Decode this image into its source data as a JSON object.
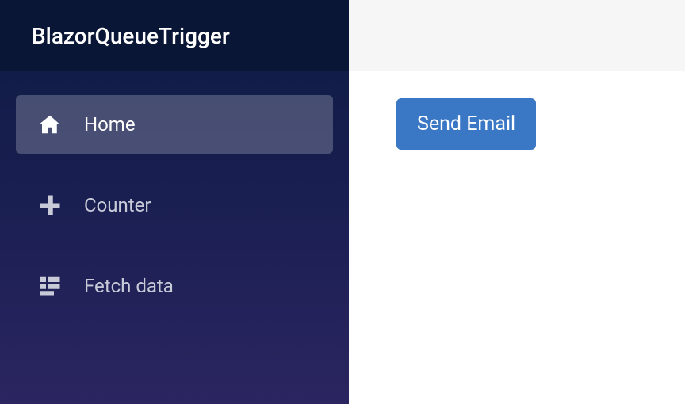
{
  "app": {
    "title": "BlazorQueueTrigger"
  },
  "sidebar": {
    "items": [
      {
        "label": "Home",
        "icon": "home-icon",
        "active": true
      },
      {
        "label": "Counter",
        "icon": "plus-icon",
        "active": false
      },
      {
        "label": "Fetch data",
        "icon": "list-icon",
        "active": false
      }
    ]
  },
  "main": {
    "sendEmailLabel": "Send Email"
  },
  "colors": {
    "primary": "#3a78c5",
    "sidebarTop": "#0a1635",
    "sidebarGradientStart": "#0d1b42",
    "sidebarGradientEnd": "#2b2560"
  }
}
